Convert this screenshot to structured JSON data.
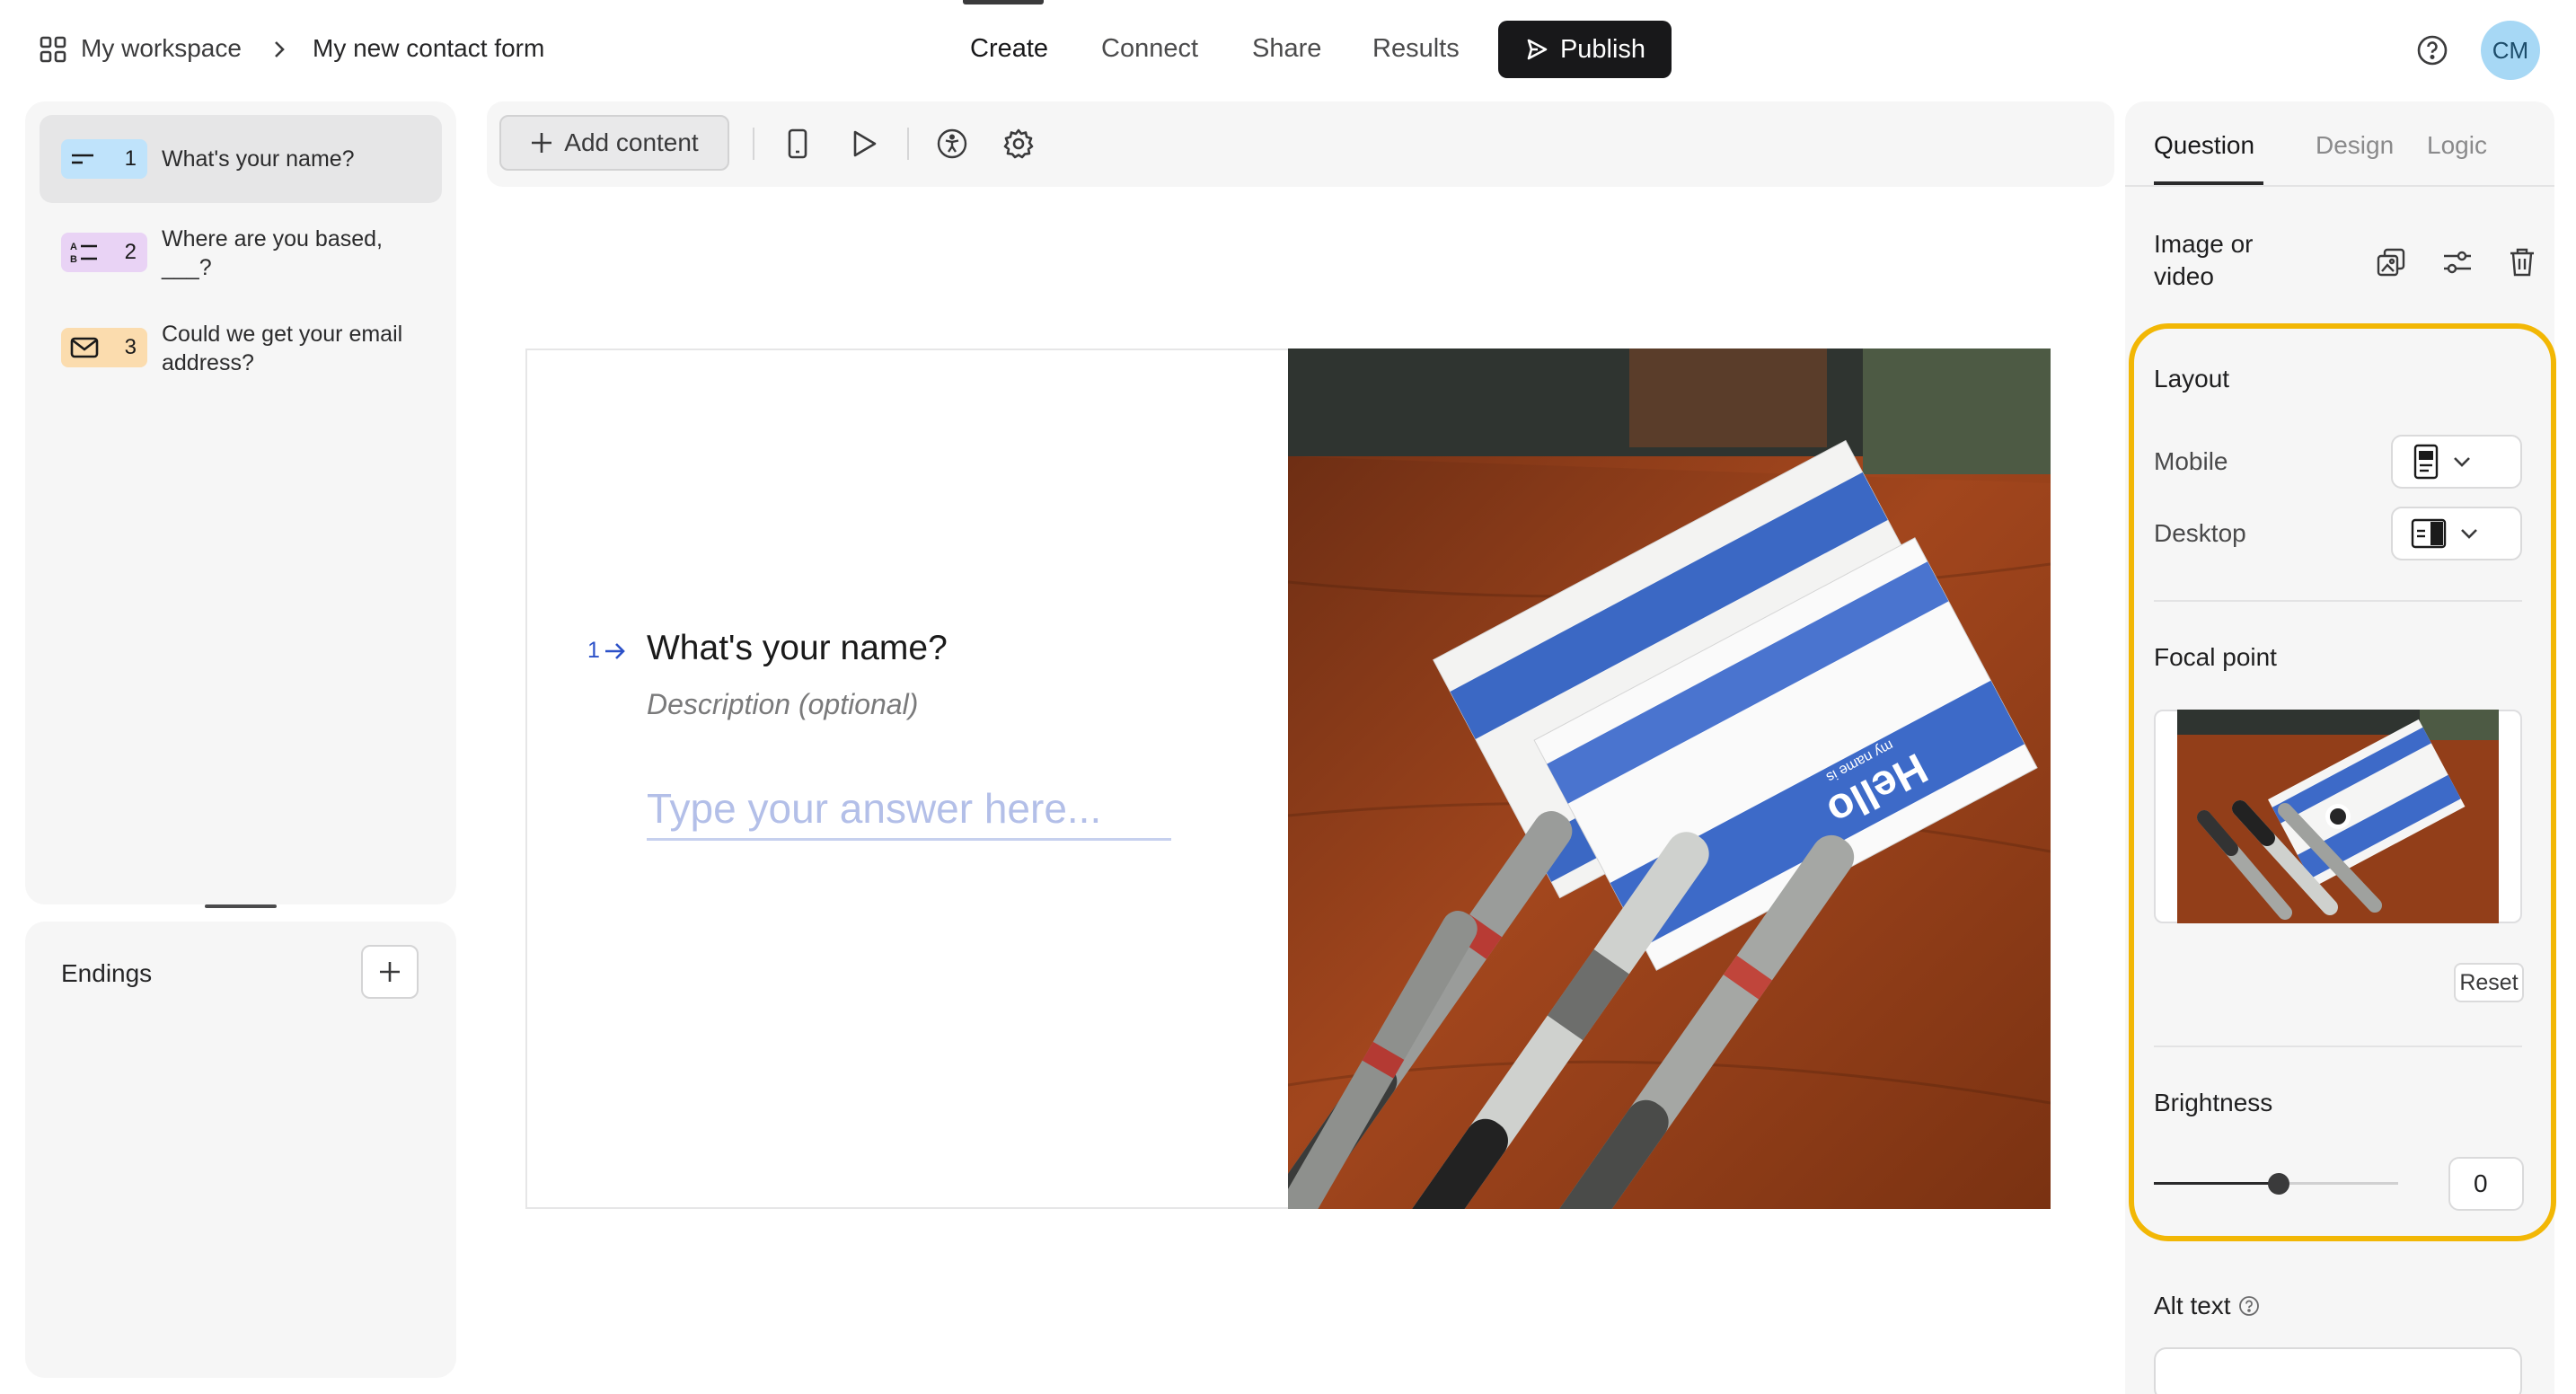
{
  "header": {
    "workspace": "My workspace",
    "form_name": "My new contact form",
    "nav": [
      "Create",
      "Connect",
      "Share",
      "Results"
    ],
    "publish": "Publish",
    "avatar": "CM"
  },
  "questions": [
    {
      "num": "1",
      "text": "What's your name?",
      "color": "#bfe3fb",
      "icon": "short-text-icon"
    },
    {
      "num": "2",
      "text": "Where are you based, ___?",
      "color": "#e9d3f5",
      "icon": "multiple-choice-icon"
    },
    {
      "num": "3",
      "text": "Could we get your email address?",
      "color": "#fbdcae",
      "icon": "email-icon"
    }
  ],
  "endings": {
    "label": "Endings"
  },
  "toolbar": {
    "add_content": "Add content"
  },
  "canvas": {
    "index": "1",
    "title": "What's your name?",
    "description": "Description (optional)",
    "placeholder": "Type your answer here..."
  },
  "right_panel": {
    "tabs": [
      "Question",
      "Design",
      "Logic"
    ],
    "image_label": "Image or video",
    "layout": "Layout",
    "mobile": "Mobile",
    "desktop": "Desktop",
    "focal_point": "Focal point",
    "reset": "Reset",
    "brightness": "Brightness",
    "brightness_value": "0",
    "alt_text": "Alt text",
    "highlight_color": "#f2b705"
  },
  "image_text": {
    "badge": "Hello",
    "badge_sub": "my name is"
  }
}
